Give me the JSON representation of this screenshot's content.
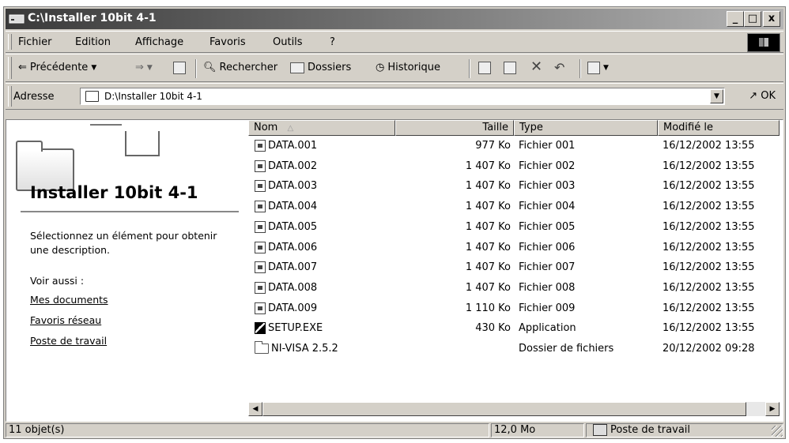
{
  "window": {
    "title": "C:\\Installer 10bit 4-1",
    "controls": {
      "minimize": "_",
      "maximize": "□",
      "close": "x"
    }
  },
  "menu": [
    "Fichier",
    "Edition",
    "Affichage",
    "Favoris",
    "Outils",
    "?"
  ],
  "toolbar": {
    "back": "Précédente",
    "search": "Rechercher",
    "folders": "Dossiers",
    "history": "Historique"
  },
  "address": {
    "label": "Adresse",
    "value": "D:\\Installer 10bit 4-1",
    "go": "OK"
  },
  "left_panel": {
    "folder_title": "Installer 10bit 4-1",
    "description": "Sélectionnez un élément pour obtenir une description.",
    "see_also": "Voir aussi :",
    "links": [
      "Mes documents",
      "Favoris réseau",
      "Poste de travail"
    ]
  },
  "columns": {
    "name": "Nom",
    "size": "Taille",
    "type": "Type",
    "modified": "Modifié le"
  },
  "files": [
    {
      "name": "DATA.001",
      "size": "977 Ko",
      "type": "Fichier 001",
      "modified": "16/12/2002 13:55",
      "icon": "data-file-icon"
    },
    {
      "name": "DATA.002",
      "size": "1 407 Ko",
      "type": "Fichier 002",
      "modified": "16/12/2002 13:55",
      "icon": "data-file-icon"
    },
    {
      "name": "DATA.003",
      "size": "1 407 Ko",
      "type": "Fichier 003",
      "modified": "16/12/2002 13:55",
      "icon": "data-file-icon"
    },
    {
      "name": "DATA.004",
      "size": "1 407 Ko",
      "type": "Fichier 004",
      "modified": "16/12/2002 13:55",
      "icon": "data-file-icon"
    },
    {
      "name": "DATA.005",
      "size": "1 407 Ko",
      "type": "Fichier 005",
      "modified": "16/12/2002 13:55",
      "icon": "data-file-icon"
    },
    {
      "name": "DATA.006",
      "size": "1 407 Ko",
      "type": "Fichier 006",
      "modified": "16/12/2002 13:55",
      "icon": "data-file-icon"
    },
    {
      "name": "DATA.007",
      "size": "1 407 Ko",
      "type": "Fichier 007",
      "modified": "16/12/2002 13:55",
      "icon": "data-file-icon"
    },
    {
      "name": "DATA.008",
      "size": "1 407 Ko",
      "type": "Fichier 008",
      "modified": "16/12/2002 13:55",
      "icon": "data-file-icon"
    },
    {
      "name": "DATA.009",
      "size": "1 110 Ko",
      "type": "Fichier 009",
      "modified": "16/12/2002 13:55",
      "icon": "data-file-icon"
    },
    {
      "name": "SETUP.EXE",
      "size": "430 Ko",
      "type": "Application",
      "modified": "16/12/2002 13:55",
      "icon": "setup-exe-icon"
    },
    {
      "name": "NI-VISA 2.5.2",
      "size": "",
      "type": "Dossier de fichiers",
      "modified": "20/12/2002 09:28",
      "icon": "folder-icon"
    }
  ],
  "status": {
    "objects": "11 objet(s)",
    "size": "12,0 Mo",
    "zone": "Poste de travail"
  }
}
